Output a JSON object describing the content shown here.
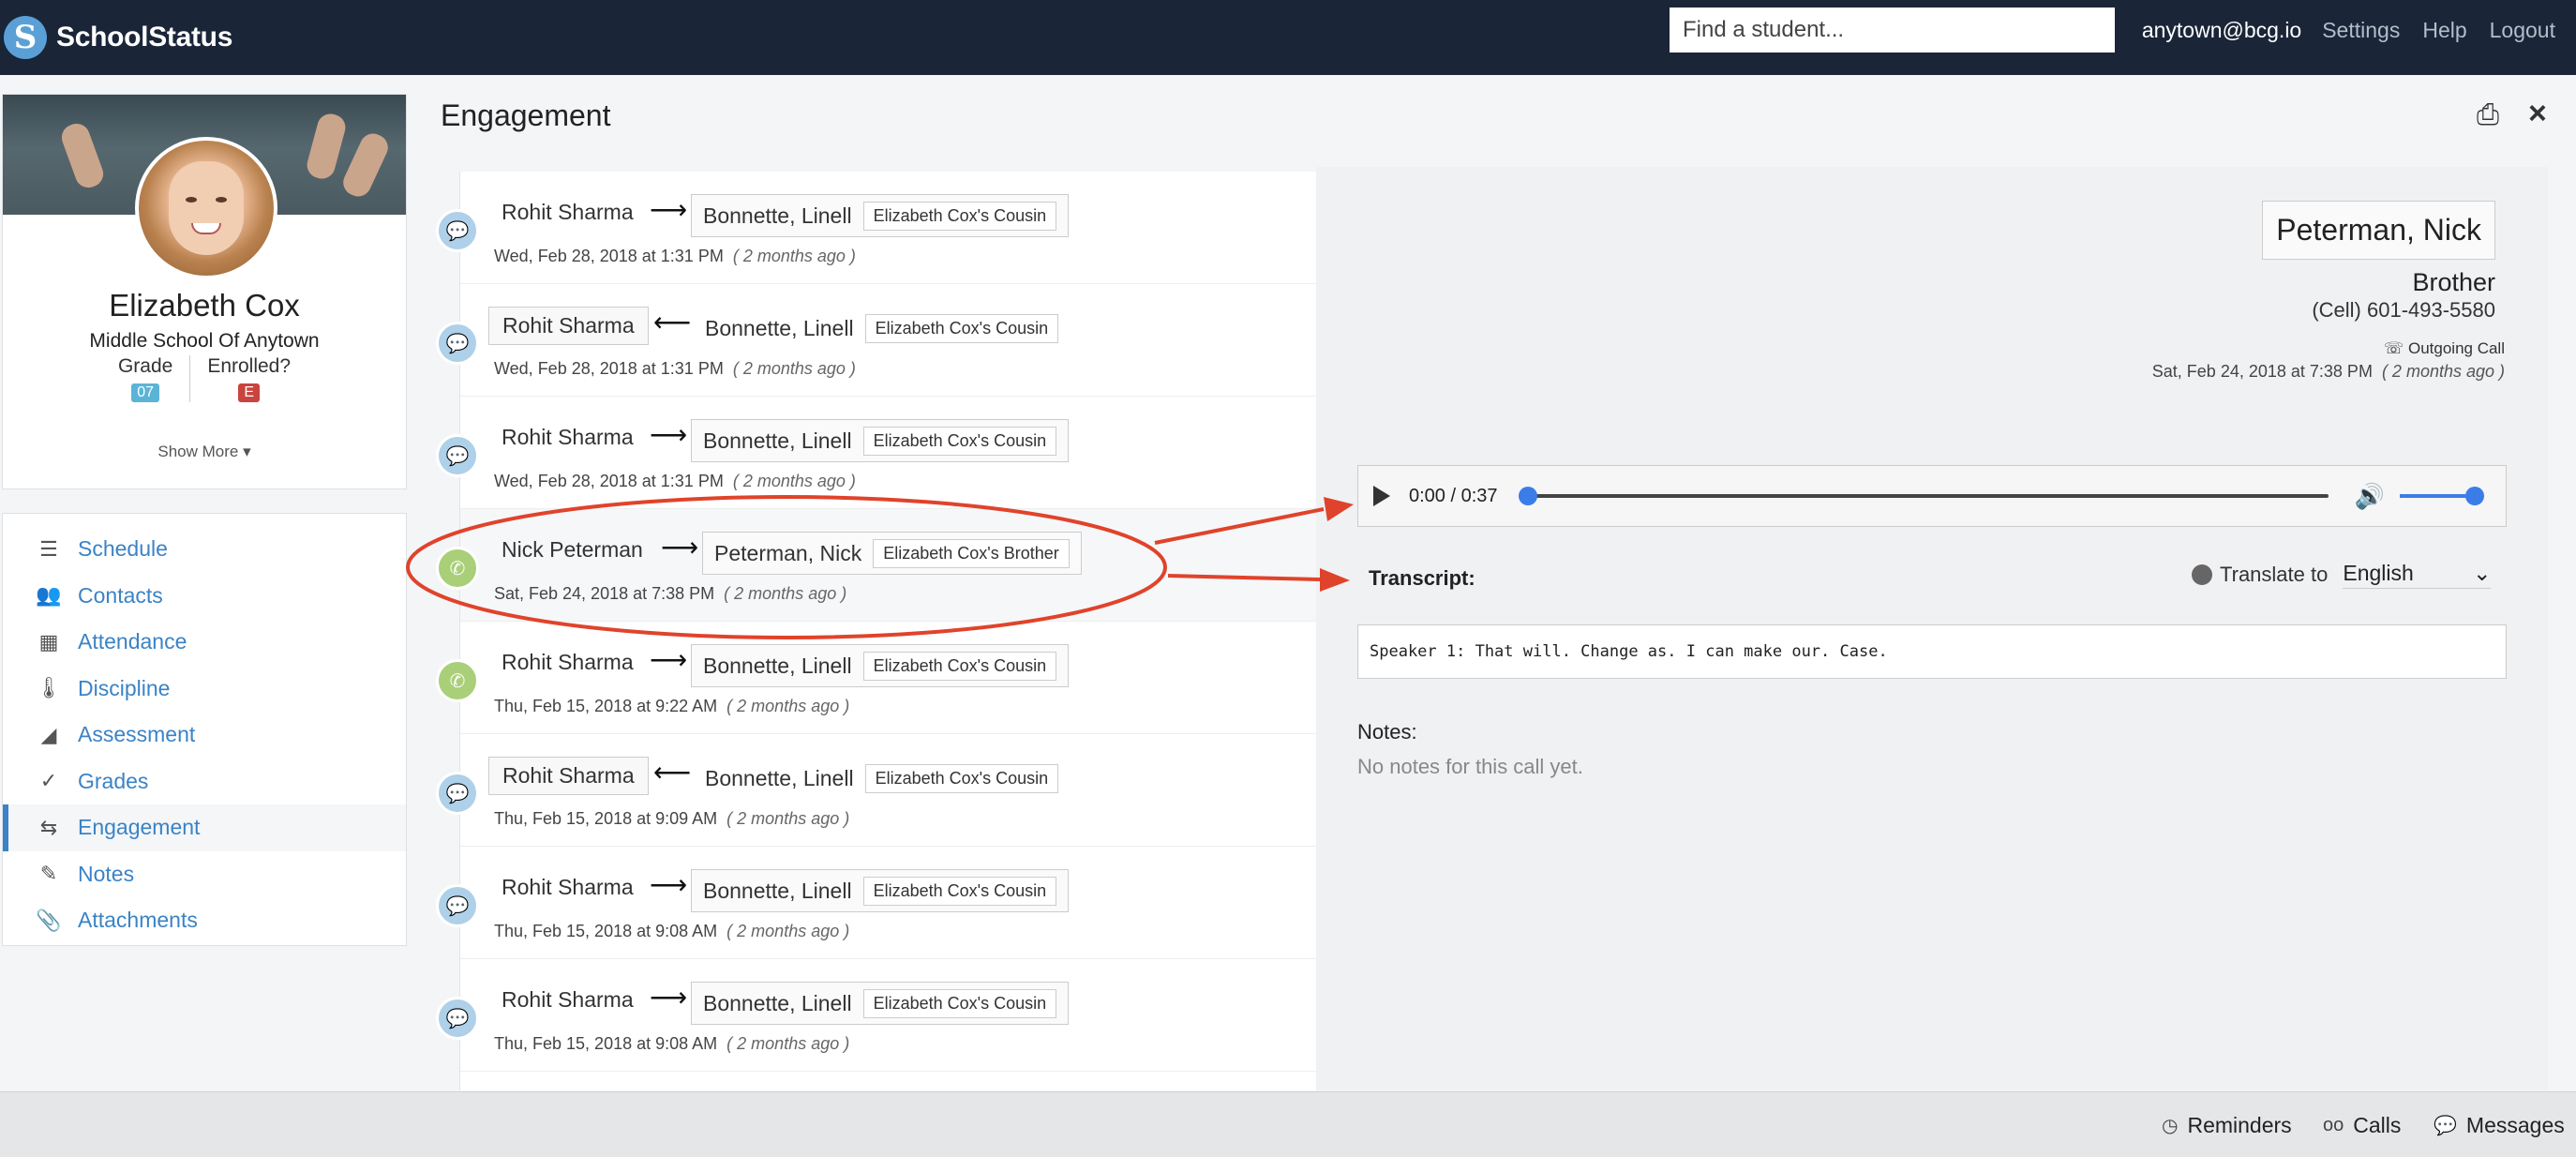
{
  "header": {
    "brand": "SchoolStatus",
    "logo_glyph": "S",
    "search_placeholder": "Find a student...",
    "user_email": "anytown@bcg.io",
    "settings": "Settings",
    "help": "Help",
    "logout": "Logout"
  },
  "student": {
    "name": "Elizabeth Cox",
    "school": "Middle School Of Anytown",
    "grade_label": "Grade",
    "grade_value": "07",
    "enrolled_label": "Enrolled?",
    "enrolled_value": "E",
    "show_more": "Show More ▾"
  },
  "nav": {
    "items": [
      {
        "label": "Schedule",
        "icon": "list-icon",
        "glyph": "☰"
      },
      {
        "label": "Contacts",
        "icon": "people-icon",
        "glyph": "👥"
      },
      {
        "label": "Attendance",
        "icon": "calendar-icon",
        "glyph": "▦"
      },
      {
        "label": "Discipline",
        "icon": "thermometer-icon",
        "glyph": "🌡"
      },
      {
        "label": "Assessment",
        "icon": "area-chart-icon",
        "glyph": "◢"
      },
      {
        "label": "Grades",
        "icon": "check-icon",
        "glyph": "✓"
      },
      {
        "label": "Engagement",
        "icon": "exchange-icon",
        "glyph": "⇆"
      },
      {
        "label": "Notes",
        "icon": "pencil-icon",
        "glyph": "✎"
      },
      {
        "label": "Attachments",
        "icon": "paperclip-icon",
        "glyph": "📎"
      }
    ]
  },
  "page": {
    "title": "Engagement"
  },
  "timeline": [
    {
      "type": "message",
      "sender": "Rohit Sharma",
      "direction": "out",
      "recipient": "Bonnette, Linell",
      "relation": "Elizabeth Cox's Cousin",
      "date": "Wed, Feb 28, 2018 at 1:31 PM",
      "ago": "( 2 months ago )"
    },
    {
      "type": "message",
      "sender": "Rohit Sharma",
      "direction": "in",
      "recipient": "Bonnette, Linell",
      "relation": "Elizabeth Cox's Cousin",
      "date": "Wed, Feb 28, 2018 at 1:31 PM",
      "ago": "( 2 months ago )"
    },
    {
      "type": "message",
      "sender": "Rohit Sharma",
      "direction": "out",
      "recipient": "Bonnette, Linell",
      "relation": "Elizabeth Cox's Cousin",
      "date": "Wed, Feb 28, 2018 at 1:31 PM",
      "ago": "( 2 months ago )"
    },
    {
      "type": "call",
      "sender": "Nick Peterman",
      "direction": "out",
      "recipient": "Peterman, Nick",
      "relation": "Elizabeth Cox's Brother",
      "date": "Sat, Feb 24, 2018 at 7:38 PM",
      "ago": "( 2 months ago )",
      "selected": true
    },
    {
      "type": "call",
      "sender": "Rohit Sharma",
      "direction": "out",
      "recipient": "Bonnette, Linell",
      "relation": "Elizabeth Cox's Cousin",
      "date": "Thu, Feb 15, 2018 at 9:22 AM",
      "ago": "( 2 months ago )"
    },
    {
      "type": "message",
      "sender": "Rohit Sharma",
      "direction": "in",
      "recipient": "Bonnette, Linell",
      "relation": "Elizabeth Cox's Cousin",
      "date": "Thu, Feb 15, 2018 at 9:09 AM",
      "ago": "( 2 months ago )"
    },
    {
      "type": "message",
      "sender": "Rohit Sharma",
      "direction": "out",
      "recipient": "Bonnette, Linell",
      "relation": "Elizabeth Cox's Cousin",
      "date": "Thu, Feb 15, 2018 at 9:08 AM",
      "ago": "( 2 months ago )"
    },
    {
      "type": "message",
      "sender": "Rohit Sharma",
      "direction": "out",
      "recipient": "Bonnette, Linell",
      "relation": "Elizabeth Cox's Cousin",
      "date": "Thu, Feb 15, 2018 at 9:08 AM",
      "ago": "( 2 months ago )"
    }
  ],
  "detail": {
    "contact_name": "Peterman, Nick",
    "relation": "Brother",
    "phone": "(Cell) 601-493-5580",
    "call_type": "Outgoing Call",
    "call_date": "Sat, Feb 24, 2018 at 7:38 PM",
    "call_ago": "( 2 months ago )",
    "audio_time": "0:00 / 0:37",
    "audio_progress": 0,
    "volume_level": 1.0,
    "transcript_label": "Transcript:",
    "translate_label": "Translate to",
    "language": "English",
    "transcript_text": "Speaker 1: That will. Change as. I can make our. Case.",
    "notes_label": "Notes:",
    "notes_empty": "No notes for this call yet."
  },
  "footer": {
    "reminders": "Reminders",
    "calls": "Calls",
    "messages": "Messages"
  },
  "colors": {
    "topbar": "#1a2538",
    "link_blue": "#3a83c6",
    "annotation_red": "#e0432b",
    "message_icon": "#aed0e9",
    "call_icon": "#a9cf78"
  }
}
